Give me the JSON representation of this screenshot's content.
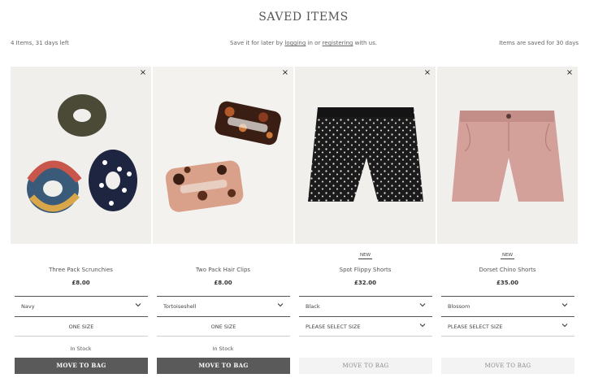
{
  "page": {
    "title": "SAVED ITEMS",
    "info_left": "4 Items, 31 days left",
    "info_center_prefix": "Save it for later by ",
    "login_link": "logging",
    "info_center_mid": " in or ",
    "register_link": "registering",
    "info_center_suffix": " with us.",
    "info_right": "Items are saved for 30 days"
  },
  "items": [
    {
      "name": "Three Pack Scrunchies",
      "price": "£8.00",
      "badge": "",
      "color": "Navy",
      "size": "ONE SIZE",
      "stock": "In Stock",
      "button": "MOVE TO BAG",
      "close": "×"
    },
    {
      "name": "Two Pack Hair Clips",
      "price": "£8.00",
      "badge": "",
      "color": "Tortoiseshell",
      "size": "ONE SIZE",
      "stock": "In Stock",
      "button": "MOVE TO BAG",
      "close": "×"
    },
    {
      "name": "Spot Flippy Shorts",
      "price": "£32.00",
      "badge": "NEW",
      "color": "Black",
      "size": "PLEASE SELECT SIZE",
      "stock": "",
      "button": "MOVE TO BAG",
      "close": "×"
    },
    {
      "name": "Dorset Chino Shorts",
      "price": "£35.00",
      "badge": "NEW",
      "color": "Blossom",
      "size": "PLEASE SELECT SIZE",
      "stock": "",
      "button": "MOVE TO BAG",
      "close": "×"
    }
  ],
  "colors": {
    "button_active": "#5a5a5a",
    "button_disabled": "#f3f3f3"
  }
}
